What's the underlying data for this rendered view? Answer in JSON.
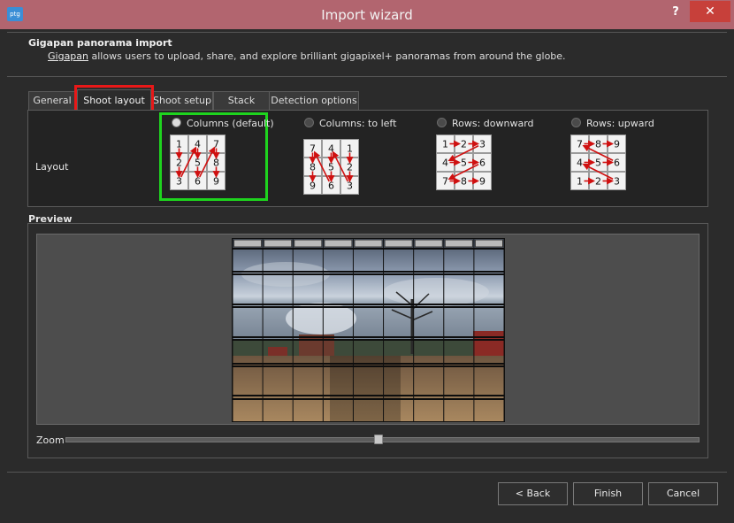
{
  "window": {
    "title": "Import wizard",
    "app_icon_text": "ptg",
    "help_label": "?",
    "close_label": "✕"
  },
  "header": {
    "title": "Gigapan panorama import",
    "link": "Gigapan",
    "description_rest": " allows users to upload, share, and explore brilliant gigapixel+ panoramas from around the globe."
  },
  "tabs": [
    {
      "label": "General"
    },
    {
      "label": "Shoot layout",
      "active": true
    },
    {
      "label": "Shoot setup"
    },
    {
      "label": "Stack"
    },
    {
      "label": "Detection options"
    }
  ],
  "layout": {
    "label": "Layout",
    "options": [
      {
        "label": "Columns (default)",
        "selected": true,
        "grid": [
          "1",
          "4",
          "7",
          "2",
          "5",
          "8",
          "3",
          "6",
          "9"
        ]
      },
      {
        "label": "Columns: to left",
        "selected": false,
        "grid": [
          "7",
          "4",
          "1",
          "8",
          "5",
          "2",
          "9",
          "6",
          "3"
        ]
      },
      {
        "label": "Rows: downward",
        "selected": false,
        "grid": [
          "1",
          "2",
          "3",
          "4",
          "5",
          "6",
          "7",
          "8",
          "9"
        ]
      },
      {
        "label": "Rows: upward",
        "selected": false,
        "grid": [
          "7",
          "8",
          "9",
          "4",
          "5",
          "6",
          "1",
          "2",
          "3"
        ]
      }
    ]
  },
  "preview": {
    "label": "Preview"
  },
  "zoom": {
    "label": "Zoom",
    "value": 0.49
  },
  "buttons": {
    "back": "< Back",
    "finish": "Finish",
    "cancel": "Cancel"
  },
  "colors": {
    "titlebar": "#b2656f",
    "tab_highlight": "#e81818",
    "selection_highlight": "#1ed41e",
    "arrow": "#d01010",
    "close": "#c7403a"
  }
}
